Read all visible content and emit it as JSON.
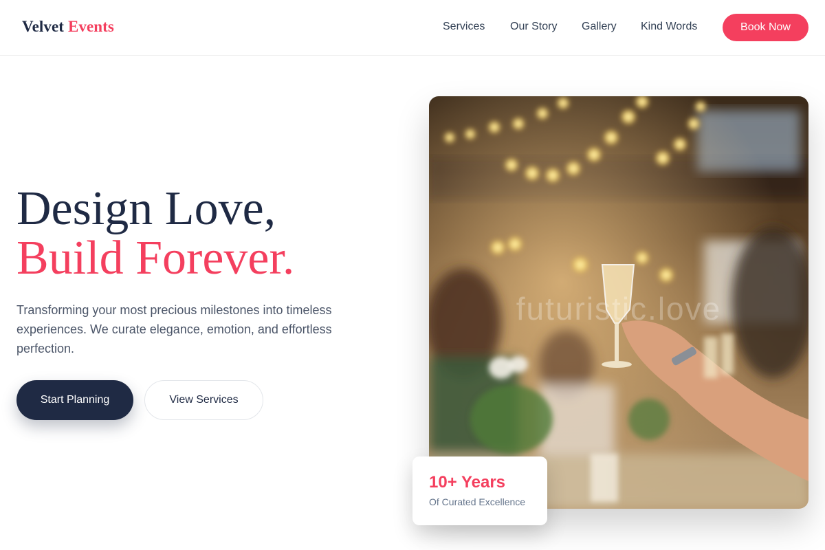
{
  "header": {
    "logo_main": "Velvet",
    "logo_accent": "Events",
    "nav": [
      {
        "label": "Services"
      },
      {
        "label": "Our Story"
      },
      {
        "label": "Gallery"
      },
      {
        "label": "Kind Words"
      }
    ],
    "cta_label": "Book Now"
  },
  "hero": {
    "title_line1": "Design Love,",
    "title_line2": "Build Forever.",
    "description": "Transforming your most precious milestones into timeless experiences. We curate elegance, emotion, and effortless perfection.",
    "primary_button": "Start Planning",
    "secondary_button": "View Services",
    "image_watermark": "futuristic.love"
  },
  "stat": {
    "value": "10+ Years",
    "label": "Of Curated Excellence"
  },
  "colors": {
    "accent": "#f43f5e",
    "navy": "#1f2a44",
    "body_text": "#4b5568"
  }
}
